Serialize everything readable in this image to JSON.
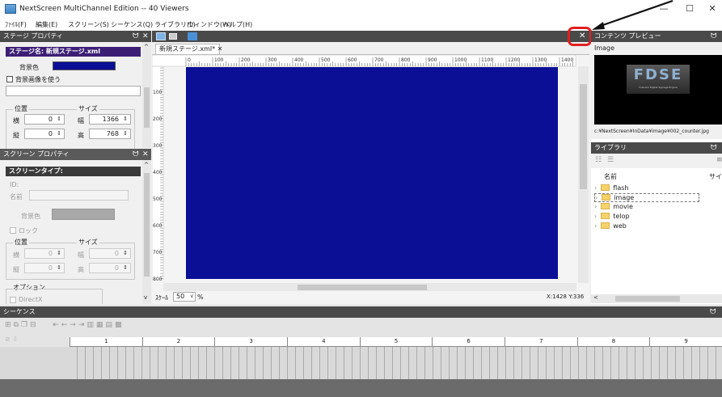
{
  "window": {
    "title": "NextScreen MultiChannel Edition -- 40 Viewers",
    "minimize": "—",
    "maximize": "☐",
    "close": "✕"
  },
  "menu": [
    "ﾌｧｲﾙ(F)",
    "編集(E)",
    "スクリーン(S)",
    "シーケンス(Q)",
    "ライブラリ(L)",
    "ウィンドウ(W)",
    "ヘルプ(H)"
  ],
  "stage_props": {
    "panel_title": "ステージ プロパティ",
    "stage_name": "ステージ名: 新規ステージ.xml",
    "bg_color_label": "背景色",
    "bg_color": "#0a0f96",
    "use_bg_image_label": "背景画像を使う",
    "position_label": "位置",
    "size_label": "サイズ",
    "x_label": "横",
    "y_label": "縦",
    "w_label": "幅",
    "h_label": "高",
    "x_value": "0",
    "y_value": "0",
    "w_value": "1366",
    "h_value": "768"
  },
  "screen_props": {
    "panel_title": "スクリーン プロパティ",
    "screen_type_label": "スクリーンタイプ:",
    "id_label": "ID:",
    "name_label": "名前",
    "bg_color_label": "背景色",
    "lock_label": "ロック",
    "position_label": "位置",
    "size_label": "サイズ",
    "x_label": "横",
    "y_label": "縦",
    "w_label": "幅",
    "h_label": "高",
    "x_value": "0",
    "y_value": "0",
    "w_value": "0",
    "h_value": "0",
    "options_label": "オプション",
    "directx_label": "DirectX"
  },
  "editor": {
    "tab_label": "新規ステージ.xml* ✕",
    "ruler_h": [
      "0",
      "100",
      "200",
      "300",
      "400",
      "500",
      "600",
      "700",
      "800",
      "900",
      "1000",
      "1100",
      "1200",
      "1300",
      "1400"
    ],
    "ruler_v": [
      "100",
      "200",
      "300",
      "400",
      "500",
      "600",
      "700",
      "800"
    ],
    "zoom_label": "ｽｹｰﾙ",
    "zoom_value": "50",
    "zoom_unit": "%",
    "coords": "X:1428  Y:336",
    "close_symbol": "✕",
    "canvas_color": "#0a0f96"
  },
  "preview": {
    "panel_title": "コンテンツ プレビュー",
    "image_label": "Image",
    "logo_text": "FDSE",
    "logo_sub": "Fukuoka Digital Signage Engine",
    "path": "c:¥NextScreen¥InData¥image¥002_counter.jpg"
  },
  "library": {
    "panel_title": "ライブラリ",
    "col_name": "名前",
    "col_size": "サイズ",
    "folders": [
      "flash",
      "image",
      "movie",
      "telop",
      "web"
    ]
  },
  "sequence": {
    "panel_title": "シーケンス",
    "columns": [
      "1",
      "2",
      "3",
      "4",
      "5",
      "6",
      "7",
      "8",
      "9"
    ]
  },
  "annotation_color": "#e02020"
}
